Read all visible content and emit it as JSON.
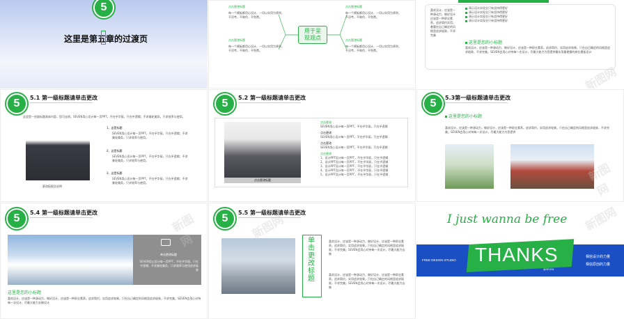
{
  "slide1": {
    "badge": "5",
    "title": "这里是第五章的过渡页"
  },
  "slide2": {
    "center": "用于呈\n现观点",
    "boxes": [
      {
        "head": "点击更改标题",
        "text": "每一个模板都用心设计，一切以实用为原则，不浮夸，不做作，不免费。"
      },
      {
        "head": "点击更改标题",
        "text": "每一个模板都用心设计，一切以实用为原则，不浮夸，不做作，不免费。"
      },
      {
        "head": "点击更改标题",
        "text": "每一个模板都用心设计，一切以实用为原则，不浮夸，不做作，不免费。"
      },
      {
        "head": "点击更改标题",
        "text": "每一个模板都用心设计，一切以实用为原则，不浮夸，不做作，不免费。"
      }
    ]
  },
  "slide3": {
    "left_text": "喜欢设计，应该是一种源动力，做好设计应该是一种职业素养，追求简约实用，着重在自己确定的风格里追求极致，不求完美",
    "list": [
      "演示设计实现业只有坚持得更好",
      "演示设计实现业只有坚持得更好",
      "演示设计实现业只有坚持得更好",
      "演示设计实现业只有坚持得更好"
    ],
    "subtitle": "这里是您的小标题",
    "body": "喜欢设计，应该是一种源动力，做好设计，应该是一种职业素养。追求简约，实用追求效果。只在自己确定的风格里追求极致，不求完美。SEVEN会用心对待每一次设计，尽最大能力为您提供最实用最便捷的商业模板设计"
  },
  "slide4": {
    "badge": "5",
    "title": "5.1 第一级标题请单击更改",
    "intro": "这里是一些副标题具体内容，您可去除。SEVEN用心设计每一页PPT，不在乎华丽，只在乎逻辑；不求美轮美奂，只求效率与使用。",
    "caption": "更改配图及说明",
    "items": [
      {
        "num": "1、",
        "head": "这是标题",
        "text": "SEVEN用心设计每一页PPT，不在乎华丽，只在乎逻辑；不求美轮美奂，只求效率与使用。"
      },
      {
        "num": "2、",
        "head": "这是标题",
        "text": "SEVEN用心设计每一页PPT，不在乎华丽，只在乎逻辑；不求美轮美奂，只求效率与使用。"
      },
      {
        "num": "3、",
        "head": "这是标题",
        "text": "SEVEN用心设计每一页PPT，不在乎华丽，只在乎逻辑；不求美轮美奂，只求效率与使用。"
      }
    ]
  },
  "slide5": {
    "badge": "5",
    "title": "5.2 第一级标题请单击更改",
    "caption": "点击更改标题",
    "groups": [
      {
        "head": "点击更改",
        "text": "SEVEN用心设计每一页PPT，不在乎华丽，只在乎逻辑"
      },
      {
        "head": "点击更改",
        "text": "SEVEN用心设计每一页PPT，不在乎华丽，只在乎逻辑"
      },
      {
        "head": "点击更改",
        "text": "SEVEN用心设计每一页PPT，不在乎华丽，只在乎逻辑"
      }
    ],
    "list_head": "点击更改",
    "list": [
      "1、设计PPT设计每一页PPT，不在乎华丽，只在乎逻辑",
      "2、设计PPT设计每一页PPT，不在乎华丽，只在乎逻辑",
      "3、设计PPT设计每一页PPT，不在乎华丽，只在乎逻辑",
      "4、设计PPT设计每一页PPT，不在乎华丽，只在乎逻辑",
      "5、设计PPT设计每一页PPT，不在乎华丽，只在乎逻辑"
    ]
  },
  "slide6": {
    "badge": "5",
    "title": "5.3第一级标题请单击更改",
    "subtitle": "这里是您的小标题",
    "body": "喜欢设计，应该是一种源动力，做好设计，应该是一种职业素养。追求简约，实用追求效果。只在自己确定的风格里追求极致，不求完美。SEVEN会用心对待每一次设计，尽最大能力为您提供"
  },
  "slide7": {
    "badge": "5",
    "title": "5.4 第一级标题请单击更改",
    "panel_head": "单击更改标题",
    "panel_text": "SEVEN用心设计每一页PPT，不在乎华丽，只在乎逻辑；不求美轮美奂，只求效率与使用追求极致",
    "subtitle": "这里是您的小标题",
    "body": "喜欢设计，应该是一种源动力，做好设计，应该是一种职业素养。追求简约，实用追求效果。只在自己确定的风格里追求极致，不求完美。SEVEN会用心对待每一次设计，尽最大能力去做设计"
  },
  "slide8": {
    "badge": "5",
    "title": "5.5 第一级标题请单击更改",
    "vertical": "单击更改标题",
    "para1": "喜欢设计，应该是一种源动力，做好设计，应该是一种职业素养。追求简约，实用追求效果。只在自己确定的风格里追求极致，不求完美。SEVEN会用心对待每一次设计，尽最大能力去做",
    "para2": "喜欢设计，应该是一种源动力，做好设计，应该是一种职业素养。追求简约，实用追求效果。只在自己确定的风格里追求极致，不求完美。SEVEN会用心对待每一次设计，尽最大能力去做"
  },
  "slide9": {
    "script": "I just wanna be free",
    "left": "FREE DESIGN STUDIO",
    "thanks": "THANKS",
    "at": "@SEVEN",
    "right1": "相信设计的力量",
    "right2": "相信原创的力量"
  },
  "watermark": "新图网"
}
